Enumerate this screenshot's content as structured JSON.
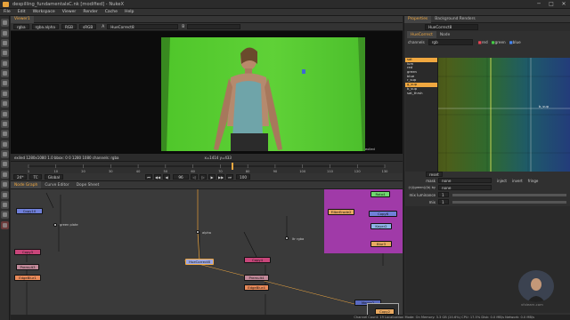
{
  "window": {
    "title": "despilling_fundamentalsC.nk [modified] - NukeX",
    "minimize": "─",
    "maximize": "□",
    "close": "✕"
  },
  "menu": [
    "File",
    "Edit",
    "Workspace",
    "Viewer",
    "Render",
    "Cache",
    "Help"
  ],
  "viewer": {
    "tab": "Viewer1",
    "controls": {
      "channels": "rgba",
      "alpha": "rgba.alpha",
      "colorspace": "RGB",
      "lut": "sRGB",
      "a_label": "A",
      "a_input": "HueCorrect8",
      "b_label": "B",
      "b_input": ""
    },
    "info_left": "exiled 1280x1080 1.0   bbox: 0 0 1280 1080 channels: rgba",
    "info_right": "x=1414 y=433",
    "corner_label": "exiled",
    "timeline_ticks": [
      "1",
      "10",
      "20",
      "30",
      "40",
      "50",
      "60",
      "70",
      "80",
      "90",
      "100",
      "110",
      "120",
      "130"
    ],
    "transport": {
      "fps": "24*",
      "tc": "TC",
      "global": "Global",
      "frame": "96",
      "end": "100"
    }
  },
  "panel_tabs": [
    "Node Graph",
    "Curve Editor",
    "Dope Sheet"
  ],
  "properties": {
    "tabs": [
      "Properties",
      "Background Renders"
    ],
    "node_name": "HueCorrect8",
    "sub_tabs": [
      "HueCorrect",
      "Node"
    ],
    "channels_label": "channels",
    "channels_value": "rgb",
    "channel_checks": [
      "red",
      "green",
      "blue"
    ],
    "curve_list": [
      "sat",
      "lum",
      "red",
      "green",
      "blue",
      "r_sup",
      "g_sup",
      "b_sup",
      "sat_thrsh"
    ],
    "curve_selected": 6,
    "curve_point_label": "b_sup",
    "mask_label": "mask",
    "mask_value": "none",
    "mask_opts": [
      "inject",
      "invert",
      "fringe"
    ],
    "r_label": "(r)/(green)/(b) by",
    "r_value": "none",
    "mix_luminance_label": "mix luminance",
    "mix_luminance_value": "1",
    "mix_label": "mix",
    "mix_value": "1",
    "reset_label": "reset"
  },
  "nodes": {
    "labels": [
      "Copy10",
      "Dot",
      "Blur4",
      "Copy3",
      "Premult3",
      "EdgeBlur1",
      "HueCorrect8",
      "Copy4",
      "Premult4",
      "EdgeBlur4",
      "Roto4",
      "Copy6",
      "Keyer2",
      "Blur3",
      "Merge2",
      "FilterErode2",
      "Copy4",
      "Copy2"
    ],
    "annotations": [
      "green plate",
      "alpha",
      "ltr rgba",
      "core matte",
      "shadow"
    ]
  },
  "status": {
    "text": "Channel Count: 19  Localization Mode: On  Memory: 3.3 GB (20.6%)  CPU: 17.5%  Disk: 0.0 MB/s  Network: 0.0 MB/s"
  },
  "watermark": "vfxlearn.com",
  "colors": {
    "accent": "#f0a840",
    "green_screen": "#5fd137",
    "node_magenta": "#a03aa8"
  }
}
